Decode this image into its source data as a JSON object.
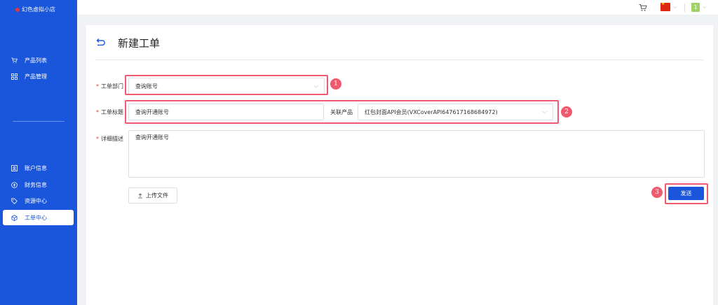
{
  "app": {
    "logo_text": "幻色虚拟小店"
  },
  "sidebar": {
    "items": [
      {
        "label": "产品列表",
        "icon": "cart-icon"
      },
      {
        "label": "产品管理",
        "icon": "grid-icon"
      },
      {
        "label": "账户信息",
        "icon": "account-icon"
      },
      {
        "label": "财务信息",
        "icon": "finance-icon"
      },
      {
        "label": "资源中心",
        "icon": "tag-icon"
      },
      {
        "label": "工单中心",
        "icon": "cube-icon",
        "active": true
      }
    ]
  },
  "header": {
    "user_initial": "1"
  },
  "page": {
    "title": "新建工单"
  },
  "form": {
    "department": {
      "label": "工单部门",
      "value": "查询账号"
    },
    "subject": {
      "label": "工单标题",
      "value": "查询开通账号"
    },
    "product": {
      "label": "关联产品",
      "value": "红包封面API会员(VXCoverAPI647617168684972)"
    },
    "description": {
      "label": "详细描述",
      "value": "查询开通账号"
    },
    "upload_label": "上传文件",
    "send_label": "发送"
  },
  "annotations": [
    "1",
    "2",
    "3"
  ],
  "colors": {
    "primary": "#1a56db",
    "annotation": "#f05a70",
    "required": "#e53935"
  }
}
